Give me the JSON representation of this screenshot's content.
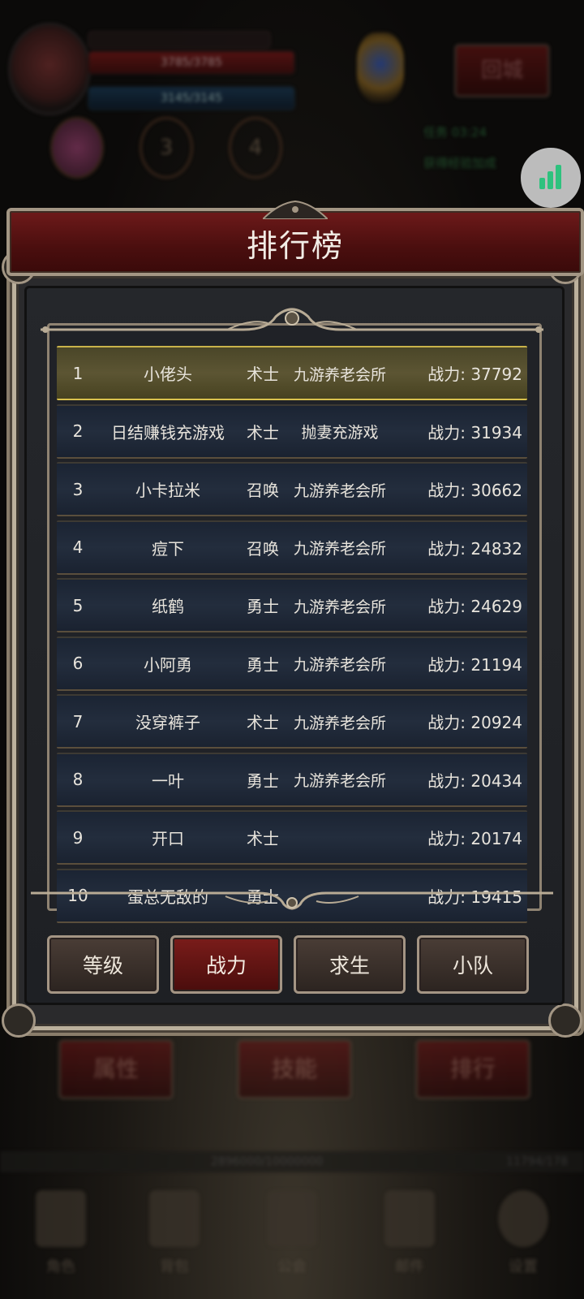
{
  "background": {
    "hp_text": "3785/3785",
    "mp_text": "3145/3145",
    "skill_slots": [
      "",
      "3",
      "4"
    ],
    "city_button": "回城",
    "info_line1": "任务  03:24",
    "info_line2": "获得经验加成",
    "lower_buttons": [
      "属性",
      "技能",
      "排行"
    ],
    "xp_text": "2896000/10000000",
    "xp_right": "11794/178",
    "nav_labels": [
      "角色",
      "背包",
      "公会",
      "邮件",
      "设置"
    ]
  },
  "dialog": {
    "title": "排行榜",
    "rows": [
      {
        "rank": "1",
        "name": "小佬头",
        "class": "术士",
        "guild": "九游养老会所",
        "power": "战力: 37792"
      },
      {
        "rank": "2",
        "name": "日结赚钱充游戏",
        "class": "术士",
        "guild": "抛妻充游戏",
        "power": "战力: 31934"
      },
      {
        "rank": "3",
        "name": "小卡拉米",
        "class": "召唤",
        "guild": "九游养老会所",
        "power": "战力: 30662"
      },
      {
        "rank": "4",
        "name": "痘下",
        "class": "召唤",
        "guild": "九游养老会所",
        "power": "战力: 24832"
      },
      {
        "rank": "5",
        "name": "纸鹤",
        "class": "勇士",
        "guild": "九游养老会所",
        "power": "战力: 24629"
      },
      {
        "rank": "6",
        "name": "小阿勇",
        "class": "勇士",
        "guild": "九游养老会所",
        "power": "战力: 21194"
      },
      {
        "rank": "7",
        "name": "没穿裤子",
        "class": "术士",
        "guild": "九游养老会所",
        "power": "战力: 20924"
      },
      {
        "rank": "8",
        "name": "一叶",
        "class": "勇士",
        "guild": "九游养老会所",
        "power": "战力: 20434"
      },
      {
        "rank": "9",
        "name": "开口",
        "class": "术士",
        "guild": "",
        "power": "战力: 20174"
      },
      {
        "rank": "10",
        "name": "蛋总无敌的",
        "class": "勇士",
        "guild": "",
        "power": "战力: 19415"
      }
    ],
    "tabs": [
      {
        "label": "等级",
        "active": false
      },
      {
        "label": "战力",
        "active": true
      },
      {
        "label": "求生",
        "active": false
      },
      {
        "label": "小队",
        "active": false
      }
    ]
  },
  "colors": {
    "accent_red": "#6e1a1a",
    "row_highlight": "#5c5533",
    "frame_gold": "#a39684"
  }
}
